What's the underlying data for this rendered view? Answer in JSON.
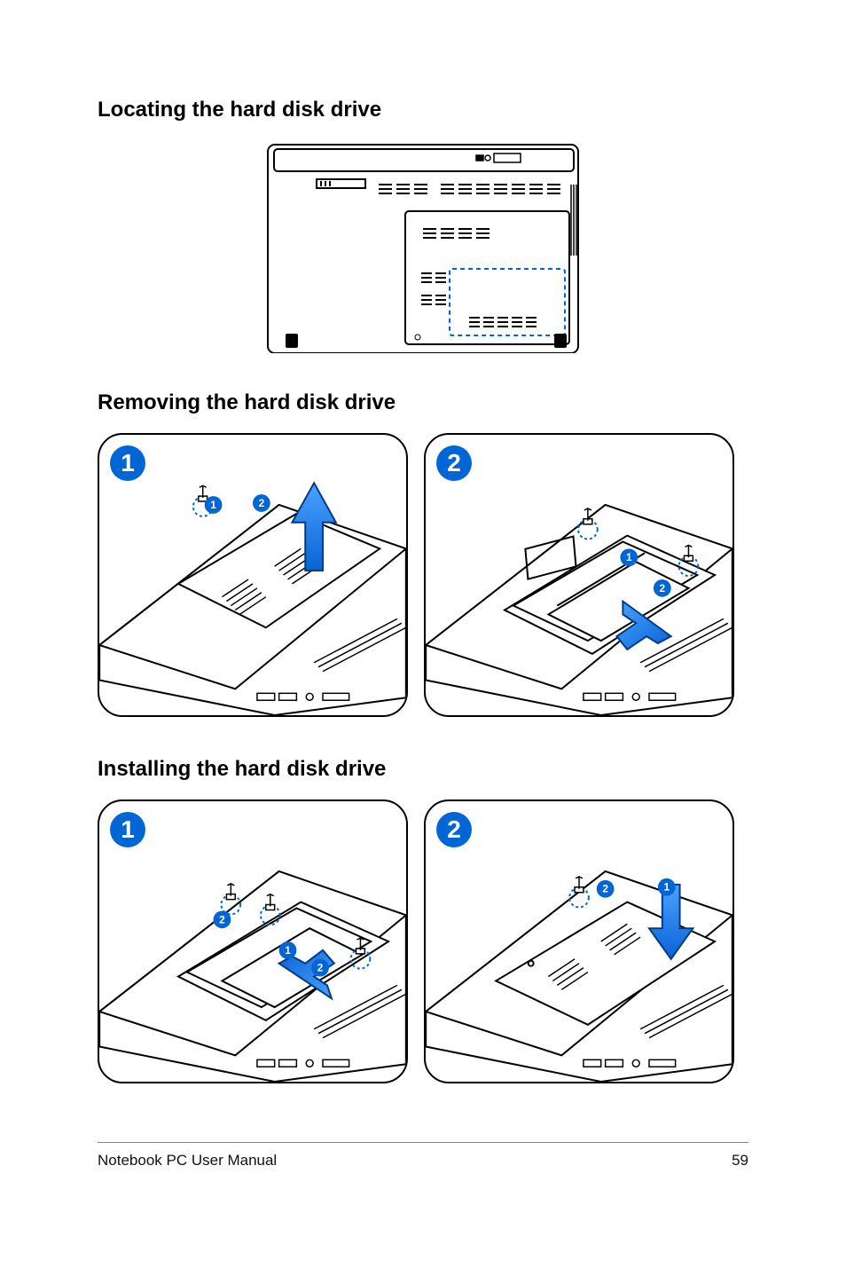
{
  "sections": {
    "locating_title": "Locating the hard disk drive",
    "removing_title": "Removing the hard disk drive",
    "installing_title": "Installing the hard disk drive"
  },
  "badges": {
    "one": "1",
    "two": "2"
  },
  "sub_badges": {
    "one": "1",
    "two": "2"
  },
  "footer": {
    "left": "Notebook PC User Manual",
    "page_number": "59"
  }
}
